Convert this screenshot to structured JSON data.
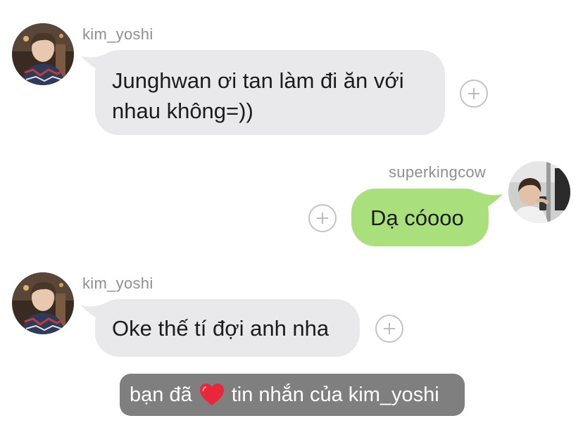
{
  "messages": [
    {
      "sender": "kim_yoshi",
      "direction": "incoming",
      "lines": [
        "Junghwan ơi tan làm đi ăn với",
        "nhau không=))"
      ],
      "avatar_icon": "user-avatar-photo",
      "react_icon": "add-reaction-icon"
    },
    {
      "sender": "superkingcow",
      "direction": "outgoing",
      "lines": [
        "Dạ cóooo"
      ],
      "avatar_icon": "user-avatar-photo",
      "react_icon": "add-reaction-icon"
    },
    {
      "sender": "kim_yoshi",
      "direction": "incoming",
      "lines": [
        "Oke thế tí đợi anh nha"
      ],
      "avatar_icon": "user-avatar-photo",
      "react_icon": "add-reaction-icon"
    }
  ],
  "notice": {
    "prefix": "bạn đã",
    "icon": "heart-icon",
    "suffix": "tin nhắn của kim_yoshi"
  },
  "colors": {
    "incoming_bubble": "#e9e9ec",
    "outgoing_bubble": "#a9e07c",
    "username": "#8e8e93",
    "notice_bg": "#7f7f7f",
    "heart": "#e8283a"
  }
}
